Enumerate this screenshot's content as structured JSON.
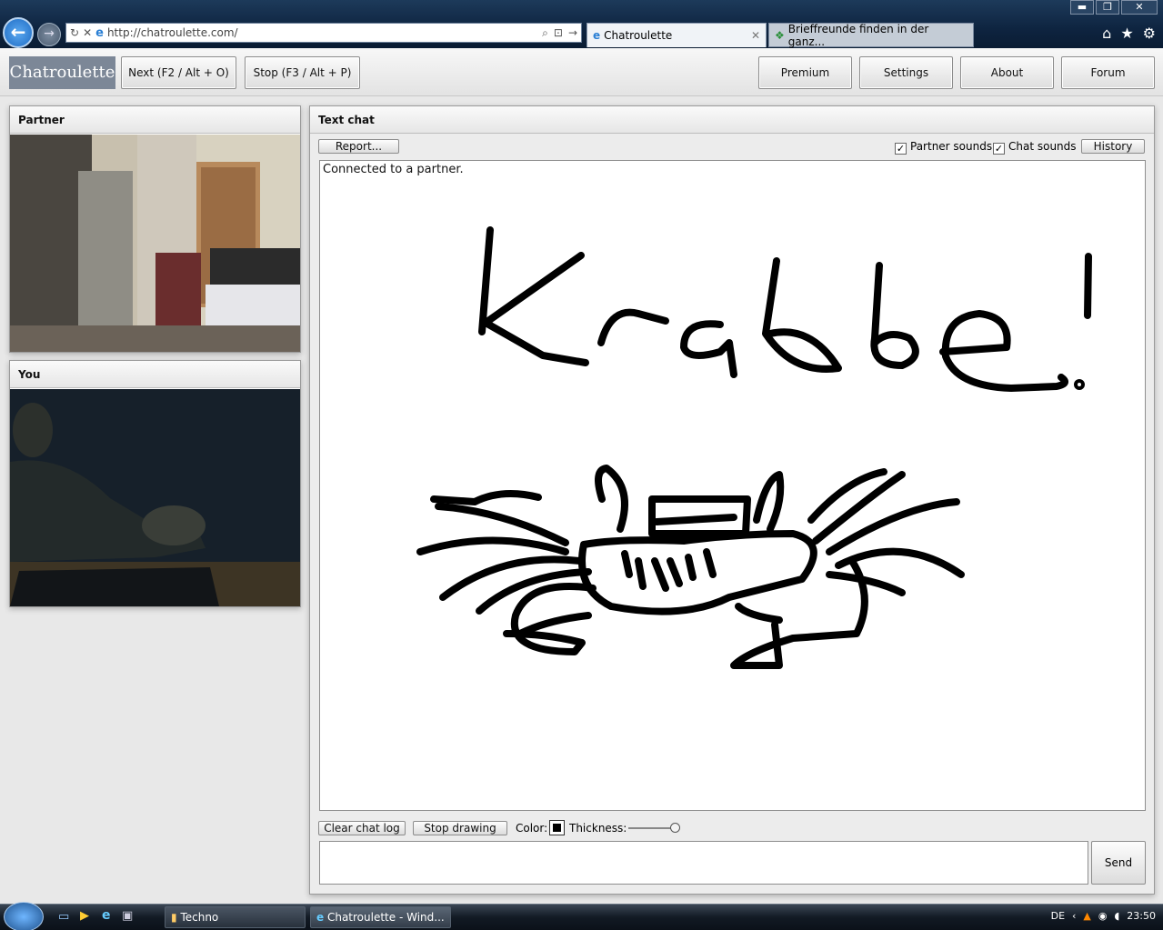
{
  "browser": {
    "address_url": "http://chatroulette.com/",
    "tabs": [
      {
        "label": "Chatroulette"
      },
      {
        "label": "Brieffreunde finden in der ganz..."
      }
    ],
    "window_controls": {
      "minimize": "▬",
      "restore": "❐",
      "close": "✕"
    }
  },
  "header": {
    "logo": "Chatroulette",
    "next_label": "Next (F2 / Alt + O)",
    "stop_label": "Stop (F3 / Alt + P)",
    "premium_label": "Premium",
    "settings_label": "Settings",
    "about_label": "About",
    "forum_label": "Forum"
  },
  "partner_panel": {
    "title": "Partner"
  },
  "you_panel": {
    "title": "You"
  },
  "text_chat": {
    "title": "Text chat",
    "report_label": "Report...",
    "partner_sounds_label": "Partner sounds",
    "partner_sounds_checked": true,
    "chat_sounds_label": "Chat sounds",
    "chat_sounds_checked": true,
    "history_label": "History",
    "messages": [
      "Connected to a partner."
    ],
    "clear_label": "Clear chat log",
    "stop_drawing_label": "Stop drawing",
    "color_label": "Color:",
    "thickness_label": "Thickness:",
    "thickness_level": 1.0,
    "send_label": "Send",
    "input_value": ""
  },
  "taskbar": {
    "items": [
      {
        "label": "Techno"
      },
      {
        "label": "Chatroulette - Wind..."
      }
    ],
    "language": "DE",
    "clock": "23:50"
  }
}
